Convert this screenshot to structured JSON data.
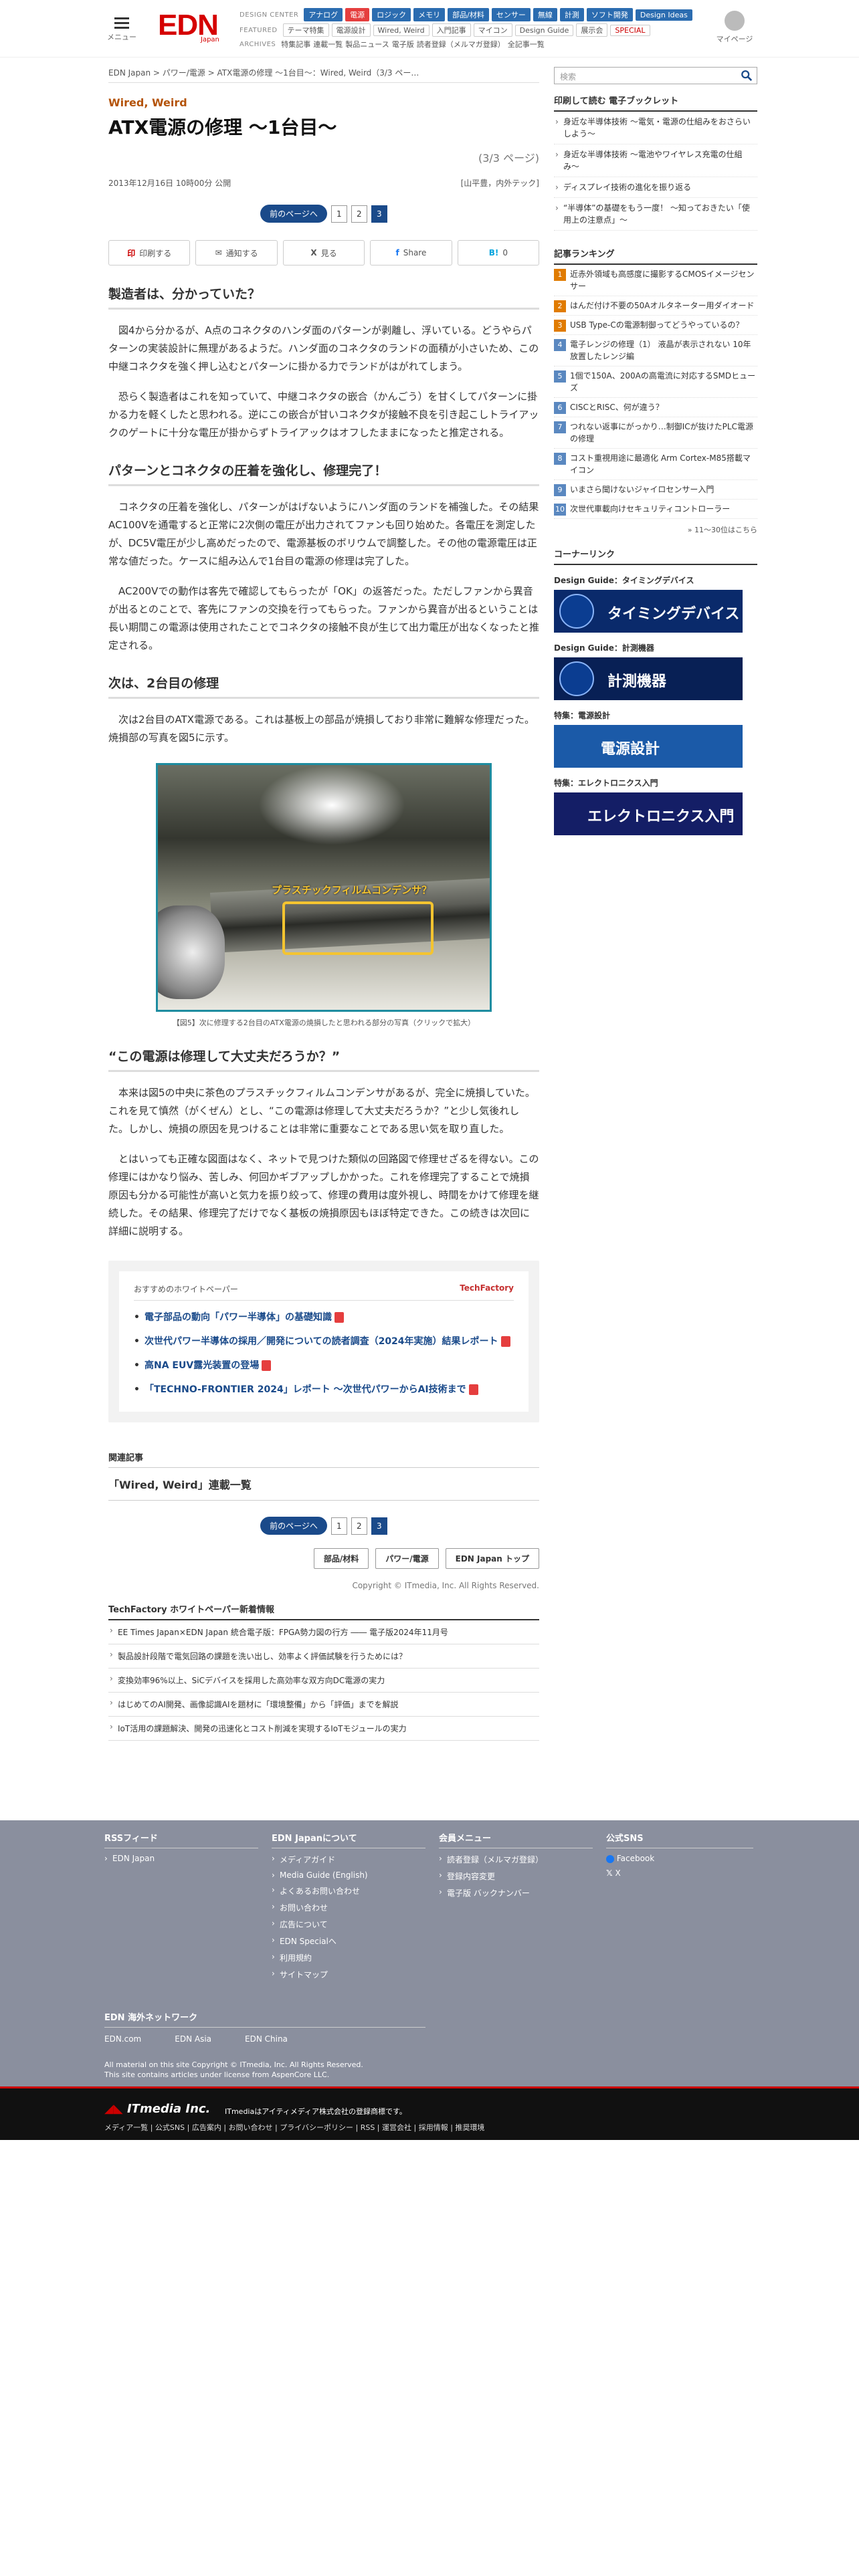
{
  "header": {
    "menu_label": "メニュー",
    "logo": "EDN",
    "logo_sub": "Japan",
    "user_label": "マイページ",
    "design_center_label": "DESIGN CENTER",
    "design_center": [
      "アナログ",
      "電源",
      "ロジック",
      "メモリ",
      "部品/材料",
      "センサー",
      "無線",
      "計測",
      "ソフト開発",
      "Design Ideas"
    ],
    "featured_label": "FEATURED",
    "featured": [
      "テーマ特集",
      "電源設計",
      "Wired, Weird",
      "入門記事",
      "マイコン",
      "Design Guide",
      "展示会",
      "SPECIAL"
    ],
    "archives_label": "ARCHIVES",
    "archives": [
      "特集記事",
      "連載一覧",
      "製品ニュース",
      "電子版",
      "読者登録（メルマガ登録）",
      "全記事一覧"
    ]
  },
  "article": {
    "breadcrumb": "EDN Japan > パワー/電源 > ATX電源の修理 〜1台目〜：Wired, Weird（3/3 ペー…",
    "category": "Wired, Weird",
    "title": "ATX電源の修理 〜1台目〜",
    "page_indicator": "(3/3 ページ)",
    "date": "2013年12月16日 10時00分 公開",
    "author": "[山平豊，内外テック]",
    "pager": {
      "prev": "前のページへ",
      "pages": [
        "1",
        "2",
        "3"
      ],
      "current": "3"
    },
    "share": [
      {
        "icon": "印",
        "label": "印刷する"
      },
      {
        "icon": "✉",
        "label": "通知する"
      },
      {
        "icon": "X",
        "label": "見る"
      },
      {
        "icon": "f",
        "label": "Share"
      },
      {
        "icon": "B!",
        "label": "0"
      }
    ],
    "sections": [
      {
        "heading": "製造者は、分かっていた？",
        "paras": [
          "図4から分かるが、A点のコネクタのハンダ面のパターンが剥離し、浮いている。どうやらパターンの実装設計に無理があるようだ。ハンダ面のコネクタのランドの面積が小さいため、この中継コネクタを強く押し込むとパターンに掛かる力でランドがはがれてしまう。",
          "恐らく製造者はこれを知っていて、中継コネクタの嵌合（かんごう）を甘くしてパターンに掛かる力を軽くしたと思われる。逆にこの嵌合が甘いコネクタが接触不良を引き起こしトライアックのゲートに十分な電圧が掛からずトライアックはオフしたままになったと推定される。"
        ]
      },
      {
        "heading": "パターンとコネクタの圧着を強化し、修理完了！",
        "paras": [
          "コネクタの圧着を強化し、パターンがはげないようにハンダ面のランドを補強した。その結果AC100Vを通電すると正常に2次側の電圧が出力されてファンも回り始めた。各電圧を測定したが、DC5V電圧が少し高めだったので、電源基板のボリウムで調整した。その他の電源電圧は正常な値だった。ケースに組み込んで1台目の電源の修理は完了した。",
          "AC200Vでの動作は客先で確認してもらったが「OK」の返答だった。ただしファンから異音が出るとのことで、客先にファンの交換を行ってもらった。ファンから異音が出るということは長い期間この電源は使用されたことでコネクタの接触不良が生じて出力電圧が出なくなったと推定される。"
        ]
      },
      {
        "heading": "次は、2台目の修理",
        "paras": [
          "次は2台目のATX電源である。これは基板上の部品が焼損しており非常に難解な修理だった。焼損部の写真を図5に示す。"
        ]
      }
    ],
    "figure": {
      "label": "プラスチックフィルムコンデンサ？",
      "caption": "【図5】次に修理する2台目のATX電源の焼損したと思われる部分の写真（クリックで拡大）"
    },
    "section4": {
      "heading": "“この電源は修理して大丈夫だろうか？”",
      "paras": [
        "本来は図5の中央に茶色のプラスチックフィルムコンデンサがあるが、完全に焼損していた。これを見て慎然（がくぜん）とし、“この電源は修理して大丈夫だろうか？”と少し気後れした。しかし、焼損の原因を見つけることは非常に重要なことである思い気を取り直した。",
        "とはいっても正確な図面はなく、ネットで見つけた類似の回路図で修理せざるを得ない。この修理にはかなり悩み、苦しみ、何回かギブアップしかかった。これを修理完了することで焼損原因も分かる可能性が高いと気力を振り絞って、修理の費用は度外視し、時間をかけて修理を継続した。その結果、修理完了だけでなく基板の焼損原因もほぼ特定できた。この続きは次回に詳細に説明する。"
      ]
    },
    "whitepaper": {
      "heading": "おすすめのホワイトペーパー",
      "brand": "TechFactory",
      "items": [
        "電子部品の動向「パワー半導体」の基礎知識",
        "次世代パワー半導体の採用／開発についての読者調査（2024年実施）結果レポート",
        "高NA EUV露光装置の登場",
        "「TECHNO-FRONTIER 2024」レポート ～次世代パワーからAI技術まで"
      ]
    },
    "related_heading": "関連記事",
    "related_item": "「Wired, Weird」連載一覧",
    "tag_buttons": [
      "部品/材料",
      "パワー/電源",
      "EDN Japan トップ"
    ],
    "copyright": "Copyright © ITmedia, Inc. All Rights Reserved.",
    "tf_heading": "TechFactory ホワイトペーパー新着情報",
    "tf_items": [
      "EE Times Japan×EDN Japan 統合電子版：FPGA勢力図の行方 ―― 電子版2024年11月号",
      "製品設計段階で電気回路の課題を洗い出し、効率よく評価試験を行うためには？",
      "変換効率96%以上、SiCデバイスを採用した高効率な双方向DC電源の実力",
      "はじめてのAI開発、画像認識AIを題材に「環境整備」から「評価」までを解説",
      "IoT活用の課題解決、開発の迅速化とコスト削減を実現するIoTモジュールの実力"
    ]
  },
  "sidebar": {
    "search_placeholder": "検索",
    "booklet_heading": "印刷して読む 電子ブックレット",
    "booklets": [
      "身近な半導体技術 〜電気・電源の仕組みをおさらいしよう〜",
      "身近な半導体技術 〜電池やワイヤレス充電の仕組み〜",
      "ディスプレイ技術の進化を振り返る",
      "“半導体”の基礎をもう一度！ ～知っておきたい「使用上の注意点」～"
    ],
    "ranking_heading": "記事ランキング",
    "ranking": [
      "近赤外領域も高感度に撮影するCMOSイメージセンサー",
      "はんだ付け不要の50Aオルタネーター用ダイオード",
      "USB Type-Cの電源制御ってどうやっているの？",
      "電子レンジの修理（1） 液晶が表示されない 10年放置したレンジ編",
      "1個で150A、200Aの高電流に対応するSMDヒューズ",
      "CISCとRISC、何が違う？",
      "つれない返事にがっかり…制御ICが抜けたPLC電源の修理",
      "コスト重視用途に最適化 Arm Cortex-M85搭載マイコン",
      "いまさら聞けないジャイロセンサー入門",
      "次世代車載向けセキュリティコントローラー"
    ],
    "ranking_more": "» 11〜30位はこちら",
    "corner_heading": "コーナーリンク",
    "corners": [
      {
        "label": "Design Guide：タイミングデバイス",
        "banner": "タイミングデバイス",
        "color": "#0a2a6b"
      },
      {
        "label": "Design Guide：計測機器",
        "banner": "計測機器",
        "color": "#082055"
      },
      {
        "label": "特集：電源設計",
        "banner": "電源設計",
        "color": "#1b5aa8"
      },
      {
        "label": "特集：エレクトロニクス入門",
        "banner": "エレクトロニクス入門",
        "color": "#141e66"
      }
    ]
  },
  "footer": {
    "rss_heading": "RSSフィード",
    "rss": [
      "EDN Japan"
    ],
    "about_heading": "EDN Japanについて",
    "about": [
      "メディアガイド",
      "Media Guide (English)",
      "よくあるお問い合わせ",
      "お問い合わせ",
      "広告について",
      "EDN Specialへ",
      "利用規約",
      "サイトマップ"
    ],
    "member_heading": "会員メニュー",
    "member": [
      "読者登録（メルマガ登録）",
      "登録内容変更",
      "電子版 バックナンバー"
    ],
    "sns_heading": "公式SNS",
    "sns": [
      "Facebook",
      "X"
    ],
    "overseas_heading": "EDN 海外ネットワーク",
    "overseas": [
      "EDN.com",
      "EDN Asia",
      "EDN China"
    ],
    "copy1": "All material on this site Copyright © ITmedia, Inc. All Rights Reserved.",
    "copy2": "This site contains articles under license from AspenCore LLC.",
    "itmedia": "ITmedia Inc.",
    "itmedia_desc": "ITmediaはアイティメディア株式会社の登録商標です。",
    "links": "メディア一覧 | 公式SNS | 広告案内 | お問い合わせ | プライバシーポリシー | RSS | 運営会社 | 採用情報 | 推奨環境"
  }
}
